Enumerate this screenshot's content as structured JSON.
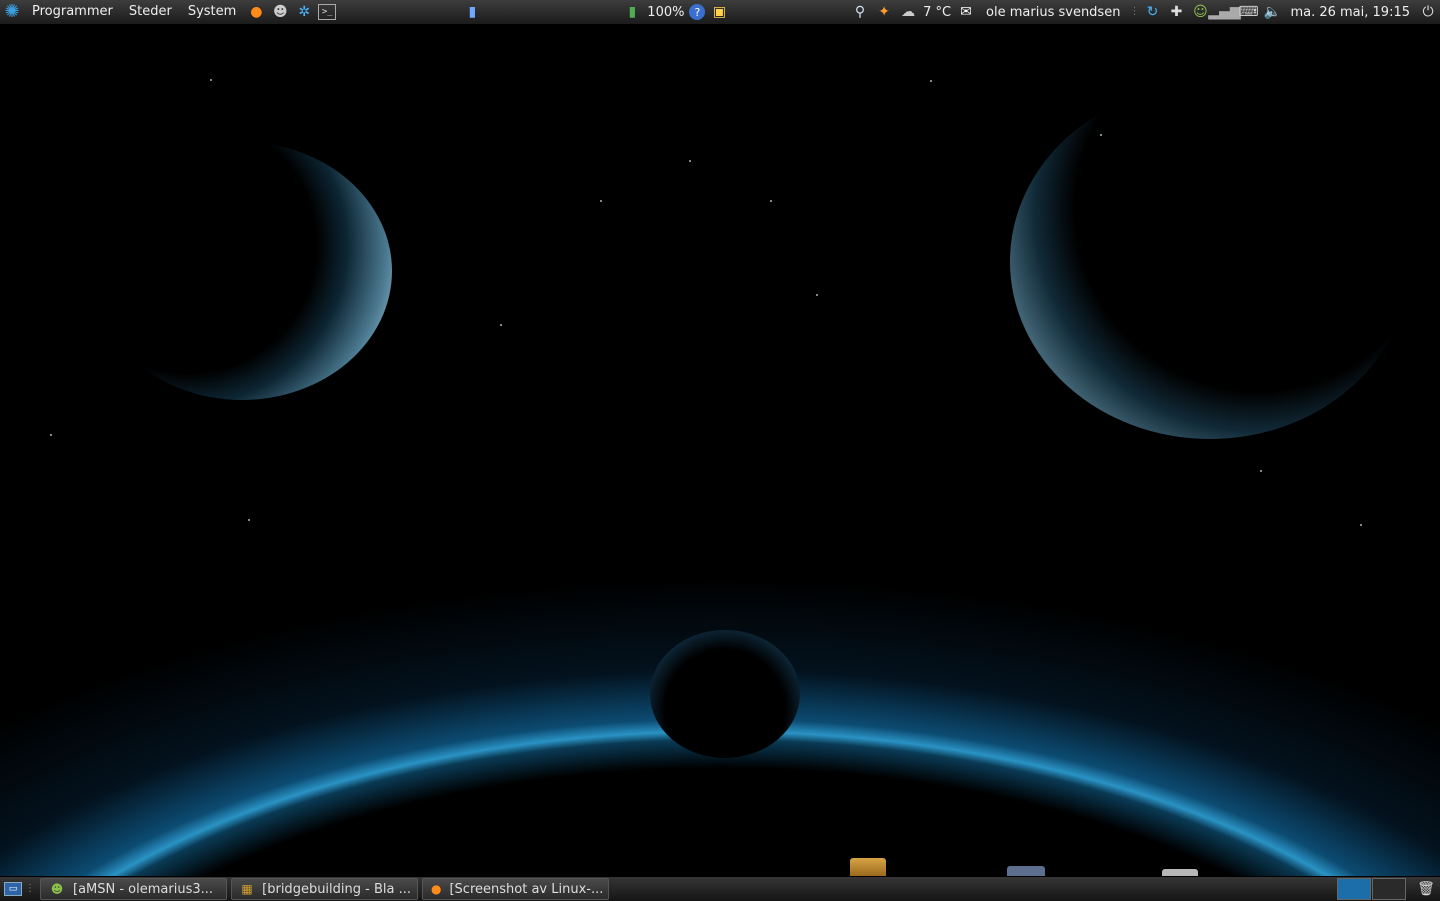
{
  "top_panel": {
    "menu": [
      {
        "label": "Programmer",
        "icon": "distro-logo-icon"
      },
      {
        "label": "Steder"
      },
      {
        "label": "System"
      }
    ],
    "launchers": [
      "firefox-icon",
      "users-icon",
      "network-icon",
      "terminal-icon"
    ],
    "battery_percent": "100%",
    "weather_temp": "7 °C",
    "user_name": "ole marius svendsen",
    "clock": "ma. 26 mai, 19:15"
  },
  "bottom_panel": {
    "tasks": [
      {
        "label": "[aMSN - olemarius3...",
        "icon": "amsn-icon"
      },
      {
        "label": "[bridgebuilding - Bla ...",
        "icon": "game-icon"
      },
      {
        "label": "[Screenshot av Linux-...",
        "icon": "firefox-icon"
      }
    ]
  },
  "colors": {
    "accent": "#1c6ea8",
    "panel": "#262626"
  }
}
